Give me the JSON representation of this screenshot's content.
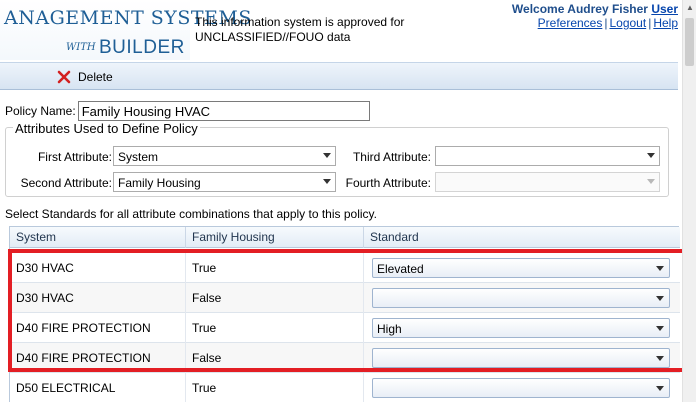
{
  "header": {
    "logo_line1": "ANAGEMENT SYSTEMS",
    "logo_with": "WITH",
    "logo_builder": "BUILDER",
    "notice": "This information system is approved for UNCLASSIFIED//FOUO data",
    "welcome": "Welcome Audrey Fisher",
    "user_link": "User",
    "preferences_link": "Preferences",
    "logout_link": "Logout",
    "help_link": "Help",
    "separator": "|"
  },
  "toolbar": {
    "delete_label": "Delete",
    "delete_icon": "close-x-icon"
  },
  "policy": {
    "name_label": "Policy Name:",
    "name_value": "Family Housing HVAC",
    "attributes_legend": "Attributes Used to Define Policy",
    "first_label": "First Attribute:",
    "first_value": "System",
    "second_label": "Second Attribute:",
    "second_value": "Family Housing",
    "third_label": "Third Attribute:",
    "third_value": "",
    "fourth_label": "Fourth Attribute:",
    "fourth_value": ""
  },
  "instructions": "Select Standards for all attribute combinations that apply to this policy.",
  "grid": {
    "columns": [
      "System",
      "Family Housing",
      "Standard"
    ],
    "rows": [
      {
        "system": "D30 HVAC",
        "family_housing": "True",
        "standard": "Elevated"
      },
      {
        "system": "D30 HVAC",
        "family_housing": "False",
        "standard": ""
      },
      {
        "system": "D40 FIRE PROTECTION",
        "family_housing": "True",
        "standard": "High"
      },
      {
        "system": "D40 FIRE PROTECTION",
        "family_housing": "False",
        "standard": ""
      },
      {
        "system": "D50 ELECTRICAL",
        "family_housing": "True",
        "standard": ""
      }
    ]
  },
  "colors": {
    "brand_blue": "#1f5f96",
    "highlight_red": "#e31e24",
    "link_blue": "#0645ad"
  }
}
